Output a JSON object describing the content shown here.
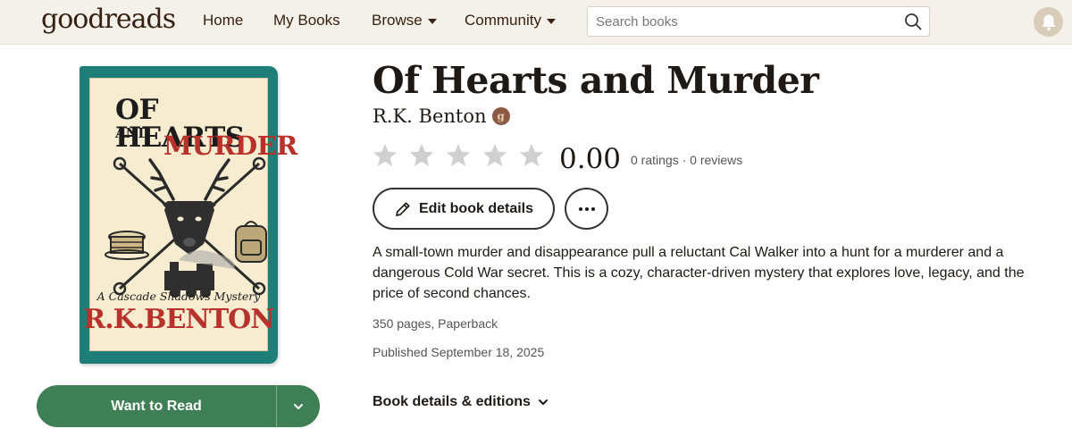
{
  "header": {
    "logo": "goodreads",
    "nav": [
      {
        "label": "Home"
      },
      {
        "label": "My Books"
      },
      {
        "label": "Browse"
      },
      {
        "label": "Community"
      }
    ],
    "search": {
      "placeholder": "Search books",
      "value": ""
    }
  },
  "cover": {
    "title_line1": "OF HEARTS",
    "title_line2": "AND",
    "title_line3": "MURDER",
    "subtitle": "A Cascade Shadows Mystery",
    "author": "R.K.BENTON",
    "frame_color": "#1f7f78",
    "accent_color": "#b8322b"
  },
  "actions": {
    "want_to_read": "Want to Read",
    "edit_details": "Edit book details",
    "accent_color": "#3f7f55"
  },
  "book": {
    "title": "Of Hearts and Murder",
    "author": "R.K. Benton",
    "author_badge": "g",
    "stars_filled": 0,
    "stars_total": 5,
    "rating": "0.00",
    "ratings_count": "0 ratings · 0 reviews",
    "description": "A small-town murder and disappearance pull a reluctant Cal Walker into a hunt for a murderer and a dangerous Cold War secret. This is a cozy, character-driven mystery that explores love, legacy, and the price of second chances.",
    "pages_format": "350 pages, Paperback",
    "published": "Published September 18, 2025",
    "details_link": "Book details & editions"
  }
}
